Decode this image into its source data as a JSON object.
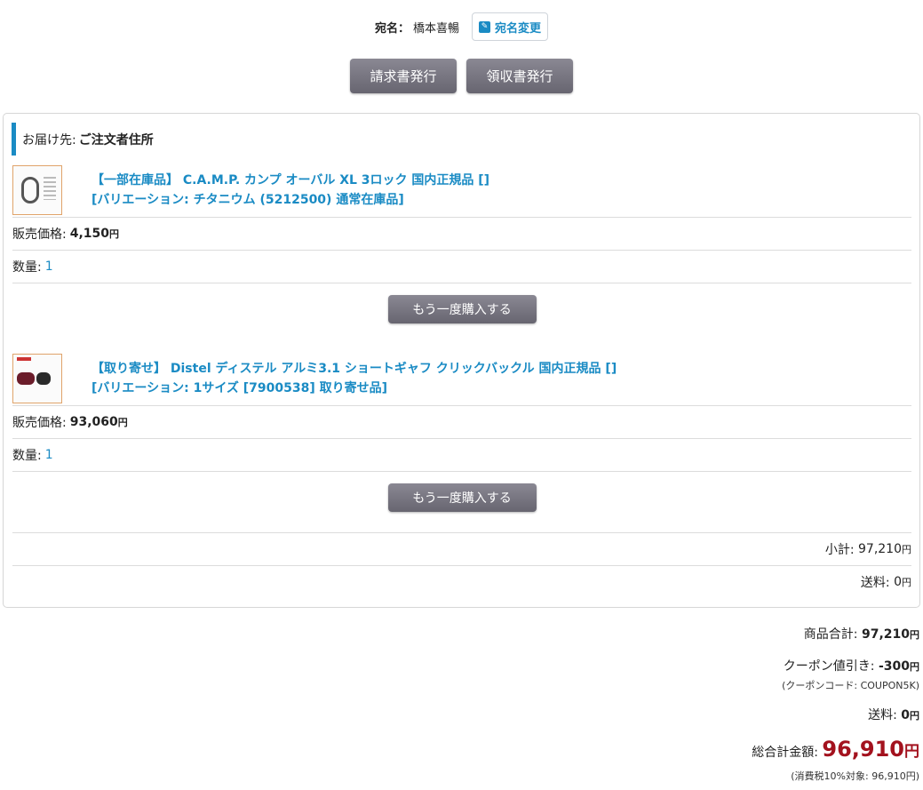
{
  "addressee": {
    "label": "宛名：",
    "name": "橋本喜暢",
    "change_label": "宛名変更"
  },
  "doc_buttons": {
    "invoice": "請求書発行",
    "receipt": "領収書発行"
  },
  "shipping": {
    "label": "お届け先:",
    "value": "ご注文者住所"
  },
  "items": [
    {
      "title_line1": "【一部在庫品】 C.A.M.P. カンプ オーバル XL 3ロック 国内正規品 []",
      "title_line2": "[バリエーション: チタニウム (5212500) 通常在庫品]",
      "price_label": "販売価格:",
      "price": "4,150",
      "yen": "円",
      "qty_label": "数量:",
      "qty": "1",
      "rebuy": "もう一度購入する"
    },
    {
      "title_line1": "【取り寄せ】 Distel ディステル アルミ3.1 ショートギャフ クリックバックル 国内正規品 []",
      "title_line2": "[バリエーション: 1サイズ [7900538] 取り寄せ品]",
      "price_label": "販売価格:",
      "price": "93,060",
      "yen": "円",
      "qty_label": "数量:",
      "qty": "1",
      "rebuy": "もう一度購入する"
    }
  ],
  "panel_totals": {
    "subtotal_label": "小計:",
    "subtotal": "97,210",
    "shipping_label": "送料:",
    "shipping": "0",
    "yen": "円"
  },
  "summary": {
    "product_total_label": "商品合計:",
    "product_total": "97,210",
    "coupon_label": "クーポン値引き:",
    "coupon": "-300",
    "coupon_code": "(クーポンコード: COUPON5K)",
    "shipping_label": "送料:",
    "shipping": "0",
    "grand_label": "総合計金額:",
    "grand_total": "96,910",
    "tax_note": "(消費税10%対象: 96,910円)",
    "yen": "円"
  },
  "colors": {
    "accent": "#1a8bc4",
    "grand_total": "#a3121e"
  }
}
